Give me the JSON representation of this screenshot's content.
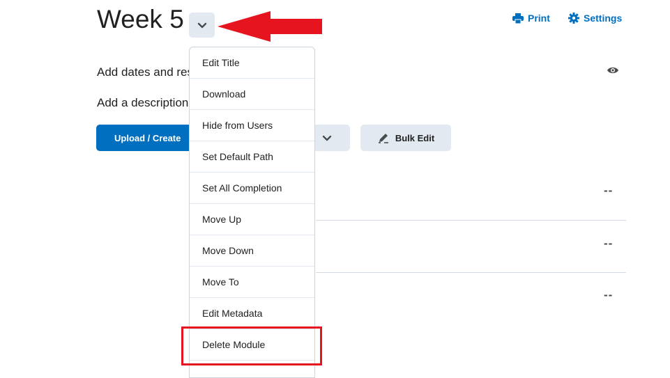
{
  "page": {
    "title": "Week 5",
    "add_dates": "Add dates and res",
    "add_description": "Add a description"
  },
  "header_links": {
    "print": "Print",
    "settings": "Settings"
  },
  "toolbar": {
    "upload_create": "Upload / Create",
    "bulk_edit": "Bulk Edit"
  },
  "rows": [
    {
      "status": "--"
    },
    {
      "status": "--"
    },
    {
      "status": "--"
    }
  ],
  "menu": {
    "items": [
      {
        "label": "Edit Title"
      },
      {
        "label": "Download"
      },
      {
        "label": "Hide from Users"
      },
      {
        "label": "Set Default Path"
      },
      {
        "label": "Set All Completion"
      },
      {
        "label": "Move Up"
      },
      {
        "label": "Move Down"
      },
      {
        "label": "Move To"
      },
      {
        "label": "Edit Metadata"
      },
      {
        "label": "Delete Module"
      }
    ]
  },
  "colors": {
    "accent": "#006fbf",
    "annotation": "#e5141f",
    "button_bg": "#e3e9f1"
  },
  "icons": [
    "chevron-down-icon",
    "printer-icon",
    "gear-icon",
    "eye-icon",
    "pencil-icon",
    "arrow-left-icon"
  ]
}
